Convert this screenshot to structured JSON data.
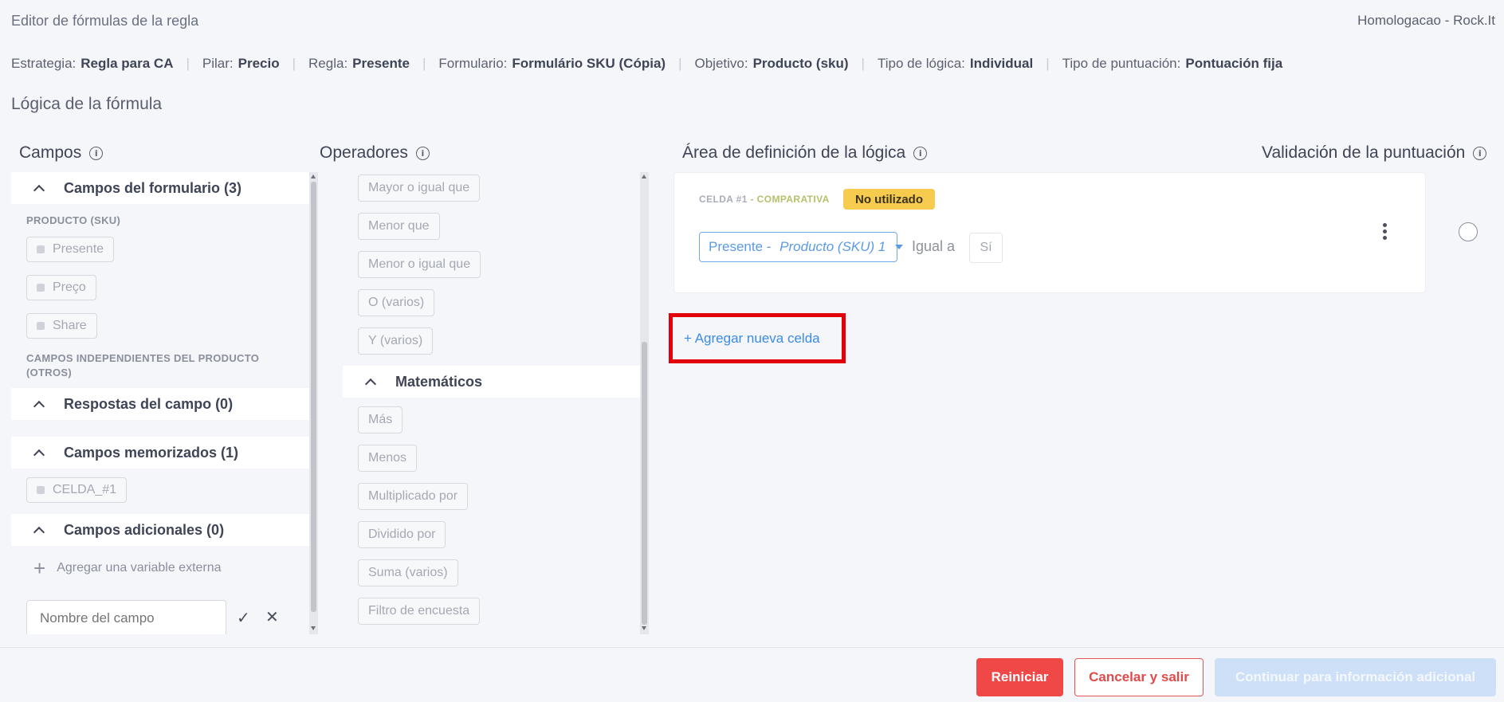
{
  "header": {
    "title": "Editor de fórmulas de la regla",
    "account": "Homologacao - Rock.It"
  },
  "meta": [
    {
      "label": "Estrategia:",
      "value": "Regla para CA"
    },
    {
      "label": "Pilar:",
      "value": "Precio"
    },
    {
      "label": "Regla:",
      "value": "Presente"
    },
    {
      "label": "Formulario:",
      "value": "Formulário SKU (Cópia)"
    },
    {
      "label": "Objetivo:",
      "value": "Producto (sku)"
    },
    {
      "label": "Tipo de lógica:",
      "value": "Individual"
    },
    {
      "label": "Tipo de puntuación:",
      "value": "Pontuación fija"
    }
  ],
  "section_title": "Lógica de la fórmula",
  "columns": {
    "fields": "Campos",
    "operators": "Operadores",
    "logic_area": "Área de definición de la lógica",
    "validation": "Validación de la puntuación"
  },
  "fields_panel": {
    "form_fields_header": "Campos del formulario (3)",
    "product_group": "PRODUCTO (SKU)",
    "product_chips": [
      "Presente",
      "Preço",
      "Share"
    ],
    "independent_group": "CAMPOS INDEPENDIENTES DEL PRODUCTO (OTROS)",
    "answers_header": "Respostas del campo (0)",
    "memorized_header": "Campos memorizados (1)",
    "memorized_chips": [
      "CELDA_#1"
    ],
    "additional_header": "Campos adicionales (0)",
    "add_external": "Agregar una variable externa",
    "field_name_placeholder": "Nombre del campo"
  },
  "operators_panel": {
    "comparison_ops": [
      "Mayor o igual que",
      "Menor que",
      "Menor o igual que",
      "O (varios)",
      "Y (varios)"
    ],
    "math_header": "Matemáticos",
    "math_ops": [
      "Más",
      "Menos",
      "Multiplicado por",
      "Dividido por",
      "Suma (varios)",
      "Filtro de encuesta"
    ]
  },
  "logic_card": {
    "cell_id": "CELDA #1",
    "cell_sep": " - ",
    "cell_type": "COMPARATIVA",
    "badge": "No utilizado",
    "select_prefix": "Presente - ",
    "select_italic": "Producto (SKU) 1",
    "operator": "Igual a",
    "value": "Sí"
  },
  "add_cell": "+ Agregar nueva celda",
  "footer": {
    "reset": "Reiniciar",
    "cancel": "Cancelar y salir",
    "continue": "Continuar para información adicional"
  },
  "colors": {
    "cell_id": "#a9adb8",
    "cell_type": "#b7c06a",
    "badge": "#f7cb4d",
    "accent_blue": "#3c8be5",
    "danger": "#f04747",
    "highlight": "#e3000b"
  }
}
